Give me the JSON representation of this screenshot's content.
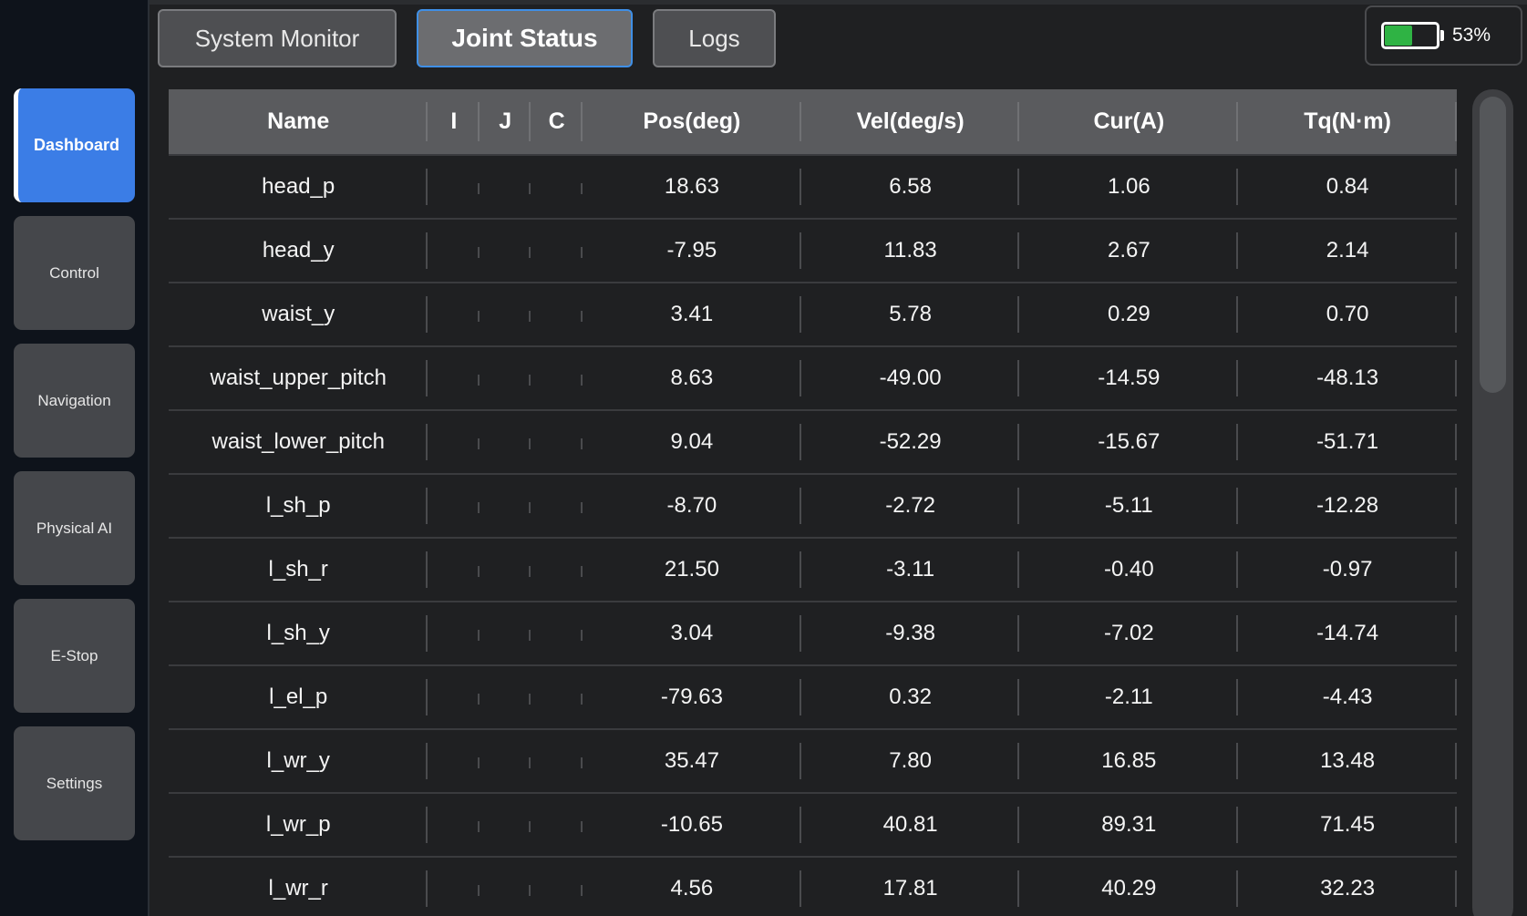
{
  "sidebar": {
    "items": [
      {
        "label": "Dashboard",
        "active": true
      },
      {
        "label": "Control"
      },
      {
        "label": "Navigation"
      },
      {
        "label": "Physical AI"
      },
      {
        "label": "E-Stop"
      },
      {
        "label": "Settings"
      }
    ]
  },
  "tabs": [
    {
      "label": "System Monitor"
    },
    {
      "label": "Joint Status",
      "active": true
    },
    {
      "label": "Logs"
    }
  ],
  "battery": {
    "percent_text": "53%",
    "level": 0.53,
    "color": "#2fb344"
  },
  "table": {
    "headers": [
      "Name",
      "I",
      "J",
      "C",
      "Pos(deg)",
      "Vel(deg/s)",
      "Cur(A)",
      "Tq(N·m)"
    ],
    "rows": [
      {
        "name": "head_p",
        "pos": "18.63",
        "vel": "6.58",
        "cur": "1.06",
        "tq": "0.84"
      },
      {
        "name": "head_y",
        "pos": "-7.95",
        "vel": "11.83",
        "cur": "2.67",
        "tq": "2.14"
      },
      {
        "name": "waist_y",
        "pos": "3.41",
        "vel": "5.78",
        "cur": "0.29",
        "tq": "0.70"
      },
      {
        "name": "waist_upper_pitch",
        "pos": "8.63",
        "vel": "-49.00",
        "cur": "-14.59",
        "tq": "-48.13"
      },
      {
        "name": "waist_lower_pitch",
        "pos": "9.04",
        "vel": "-52.29",
        "cur": "-15.67",
        "tq": "-51.71"
      },
      {
        "name": "l_sh_p",
        "pos": "-8.70",
        "vel": "-2.72",
        "cur": "-5.11",
        "tq": "-12.28"
      },
      {
        "name": "l_sh_r",
        "pos": "21.50",
        "vel": "-3.11",
        "cur": "-0.40",
        "tq": "-0.97"
      },
      {
        "name": "l_sh_y",
        "pos": "3.04",
        "vel": "-9.38",
        "cur": "-7.02",
        "tq": "-14.74"
      },
      {
        "name": "l_el_p",
        "pos": "-79.63",
        "vel": "0.32",
        "cur": "-2.11",
        "tq": "-4.43"
      },
      {
        "name": "l_wr_y",
        "pos": "35.47",
        "vel": "7.80",
        "cur": "16.85",
        "tq": "13.48"
      },
      {
        "name": "l_wr_p",
        "pos": "-10.65",
        "vel": "40.81",
        "cur": "89.31",
        "tq": "71.45"
      },
      {
        "name": "l_wr_r",
        "pos": "4.56",
        "vel": "17.81",
        "cur": "40.29",
        "tq": "32.23"
      }
    ]
  },
  "colors": {
    "accent": "#3b7de6",
    "active_tab_border": "#3f8fe6",
    "sidebar_bg": "#0e131b",
    "main_bg": "#1f2022",
    "header_bg": "#5a5b5e"
  },
  "scrollbar": {
    "thumb_fraction": 0.36
  }
}
